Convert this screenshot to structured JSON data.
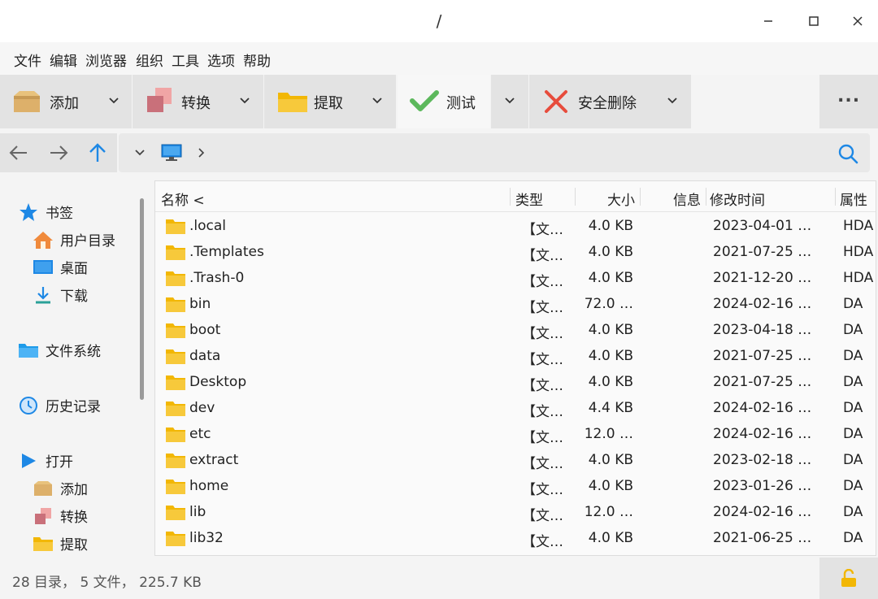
{
  "window": {
    "title": "/"
  },
  "menu": [
    "文件",
    "编辑",
    "浏览器",
    "组织",
    "工具",
    "选项",
    "帮助"
  ],
  "toolbar": {
    "add": "添加",
    "convert": "转换",
    "extract": "提取",
    "test": "测试",
    "secure_delete": "安全删除",
    "more": "..."
  },
  "sidebar": {
    "bookmarks": "书签",
    "user_dir": "用户目录",
    "desktop": "桌面",
    "downloads": "下载",
    "filesystem": "文件系统",
    "history": "历史记录",
    "open": "打开",
    "open_add": "添加",
    "open_convert": "转换",
    "open_extract": "提取"
  },
  "columns": {
    "name": "名称 <",
    "type": "类型",
    "size": "大小",
    "info": "信息",
    "modified": "修改时间",
    "attr": "属性"
  },
  "files": [
    {
      "name": ".local",
      "type": "【文…",
      "size": "4.0 KB",
      "modified": "2023-04-01 …",
      "attr": "HDA"
    },
    {
      "name": ".Templates",
      "type": "【文…",
      "size": "4.0 KB",
      "modified": "2021-07-25 …",
      "attr": "HDA"
    },
    {
      "name": ".Trash-0",
      "type": "【文…",
      "size": "4.0 KB",
      "modified": "2021-12-20 …",
      "attr": "HDA"
    },
    {
      "name": "bin",
      "type": "【文…",
      "size": "72.0 …",
      "modified": "2024-02-16 …",
      "attr": "DA"
    },
    {
      "name": "boot",
      "type": "【文…",
      "size": "4.0 KB",
      "modified": "2023-04-18 …",
      "attr": "DA"
    },
    {
      "name": "data",
      "type": "【文…",
      "size": "4.0 KB",
      "modified": "2021-07-25 …",
      "attr": "DA"
    },
    {
      "name": "Desktop",
      "type": "【文…",
      "size": "4.0 KB",
      "modified": "2021-07-25 …",
      "attr": "DA"
    },
    {
      "name": "dev",
      "type": "【文…",
      "size": "4.4 KB",
      "modified": "2024-02-16 …",
      "attr": "DA"
    },
    {
      "name": "etc",
      "type": "【文…",
      "size": "12.0 …",
      "modified": "2024-02-16 …",
      "attr": "DA"
    },
    {
      "name": "extract",
      "type": "【文…",
      "size": "4.0 KB",
      "modified": "2023-02-18 …",
      "attr": "DA"
    },
    {
      "name": "home",
      "type": "【文…",
      "size": "4.0 KB",
      "modified": "2023-01-26 …",
      "attr": "DA"
    },
    {
      "name": "lib",
      "type": "【文…",
      "size": "12.0 …",
      "modified": "2024-02-16 …",
      "attr": "DA"
    },
    {
      "name": "lib32",
      "type": "【文…",
      "size": "4.0 KB",
      "modified": "2021-06-25 …",
      "attr": "DA"
    }
  ],
  "status": {
    "text": "28 目录， 5 文件， 225.7 KB"
  },
  "colors": {
    "accent": "#1e88e5",
    "folder": "#f7c53b",
    "toolbar_bg": "#e3e3e3"
  }
}
